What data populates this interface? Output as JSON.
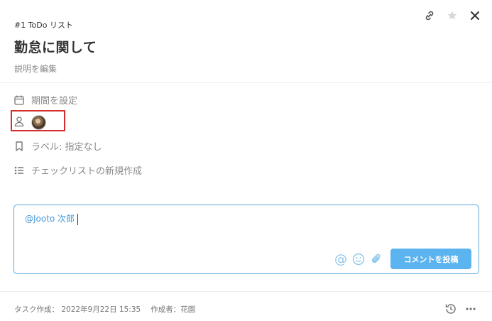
{
  "header": {
    "task_id": "#1 ToDo リスト",
    "title": "勤怠に関して",
    "description_link": "説明を編集",
    "icons": [
      "link-icon",
      "star-icon",
      "close-icon"
    ]
  },
  "properties": {
    "due_date_label": "期間を設定",
    "label_text": "ラベル: 指定なし",
    "checklist_label": "チェックリストの新規作成"
  },
  "comment": {
    "value": "@Jooto 次郎",
    "post_button": "コメントを投稿",
    "tools": [
      "mention-icon",
      "emoji-icon",
      "attach-icon"
    ]
  },
  "footer": {
    "created": "タスク作成： 2022年9月22日 15:35",
    "author": "作成者：花園",
    "icons": [
      "history-icon",
      "more-icon"
    ]
  },
  "colors": {
    "accent": "#5bb3ef",
    "comment_border": "#5ba8d8",
    "highlight": "#d32f2f"
  }
}
